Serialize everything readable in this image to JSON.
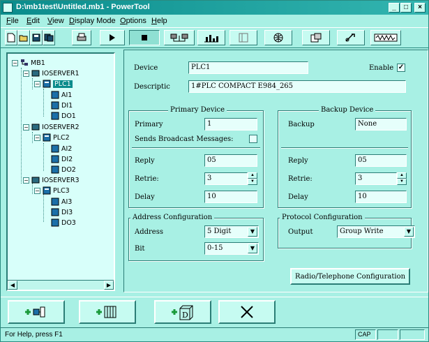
{
  "window": {
    "title": "D:\\mb1test\\Untitled.mb1 - PowerTool"
  },
  "menu": [
    "File",
    "Edit",
    "View",
    "Display Mode",
    "Options",
    "Help"
  ],
  "tree": {
    "root": "MB1",
    "servers": [
      {
        "name": "IOSERVER1",
        "plc": "PLC1",
        "points": [
          "AI1",
          "DI1",
          "DO1"
        ]
      },
      {
        "name": "IOSERVER2",
        "plc": "PLC2",
        "points": [
          "AI2",
          "DI2",
          "DO2"
        ]
      },
      {
        "name": "IOSERVER3",
        "plc": "PLC3",
        "points": [
          "AI3",
          "DI3",
          "DO3"
        ]
      }
    ]
  },
  "device": {
    "device_label": "Device",
    "device_value": "PLC1",
    "enable_label": "Enable",
    "enable_checked": "✓",
    "description_label": "Descriptic",
    "description_value": "1#PLC COMPACT E984_265"
  },
  "primary": {
    "title": "Primary Device",
    "primary_label": "Primary",
    "primary_value": "1",
    "broadcast_label": "Sends Broadcast Messages:",
    "reply_label": "Reply",
    "reply_value": "05",
    "retries_label": "Retrie:",
    "retries_value": "3",
    "delay_label": "Delay",
    "delay_value": "10"
  },
  "backup": {
    "title": "Backup Device",
    "backup_label": "Backup",
    "backup_value": "None",
    "reply_label": "Reply",
    "reply_value": "05",
    "retries_label": "Retrie:",
    "retries_value": "3",
    "delay_label": "Delay",
    "delay_value": "10"
  },
  "address": {
    "title": "Address Configuration",
    "address_label": "Address",
    "address_value": "5 Digit",
    "bit_label": "Bit",
    "bit_value": "0-15"
  },
  "protocol": {
    "title": "Protocol Configuration",
    "output_label": "Output",
    "output_value": "Group Write"
  },
  "radio_button": "Radio/Telephone Configuration",
  "status": {
    "text": "For Help, press F1",
    "cap": "CAP"
  }
}
